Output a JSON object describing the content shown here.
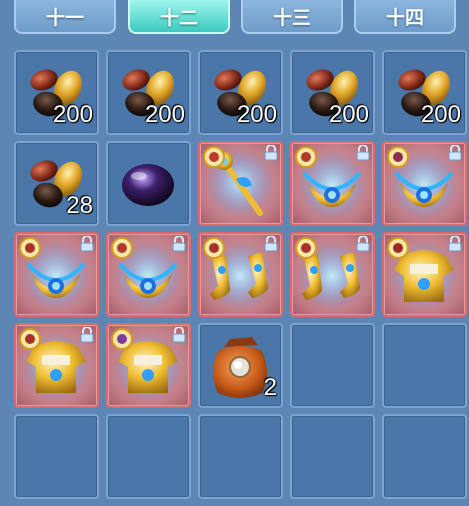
{
  "tabs": [
    {
      "label": "十一",
      "active": false
    },
    {
      "label": "十二",
      "active": true
    },
    {
      "label": "十三",
      "active": false
    },
    {
      "label": "十四",
      "active": false
    }
  ],
  "slots": [
    {
      "item": "beans",
      "count": "200",
      "locked": false
    },
    {
      "item": "beans",
      "count": "200",
      "locked": false
    },
    {
      "item": "beans",
      "count": "200",
      "locked": false
    },
    {
      "item": "beans",
      "count": "200",
      "locked": false
    },
    {
      "item": "beans",
      "count": "200",
      "locked": false
    },
    {
      "item": "beans",
      "count": "28",
      "locked": false
    },
    {
      "item": "dark-gem",
      "count": "",
      "locked": false
    },
    {
      "item": "golden-scepter",
      "count": "",
      "locked": true,
      "badge": "scepter-badge"
    },
    {
      "item": "golden-necklace",
      "count": "",
      "locked": true,
      "badge": "jar-badge"
    },
    {
      "item": "golden-necklace",
      "count": "",
      "locked": true,
      "badge": "horse-badge"
    },
    {
      "item": "golden-necklace",
      "count": "",
      "locked": true,
      "badge": "figure-badge"
    },
    {
      "item": "golden-necklace",
      "count": "",
      "locked": true,
      "badge": "jar-badge"
    },
    {
      "item": "golden-boots",
      "count": "",
      "locked": true,
      "badge": "figure-badge"
    },
    {
      "item": "golden-boots",
      "count": "",
      "locked": true,
      "badge": "figure-badge"
    },
    {
      "item": "golden-armor",
      "count": "",
      "locked": true,
      "badge": "helmet-badge"
    },
    {
      "item": "golden-armor",
      "count": "",
      "locked": true,
      "badge": "figure-badge"
    },
    {
      "item": "golden-armor",
      "count": "",
      "locked": true,
      "badge": "bird-badge"
    },
    {
      "item": "orange-pouch",
      "count": "2",
      "locked": false
    },
    {
      "item": "empty",
      "count": "",
      "locked": false
    },
    {
      "item": "empty",
      "count": "",
      "locked": false
    },
    {
      "item": "empty",
      "count": "",
      "locked": false
    },
    {
      "item": "empty",
      "count": "",
      "locked": false
    },
    {
      "item": "empty",
      "count": "",
      "locked": false
    },
    {
      "item": "empty",
      "count": "",
      "locked": false
    },
    {
      "item": "empty",
      "count": "",
      "locked": false
    }
  ],
  "colors": {
    "background": "#5d86b4",
    "active_tab": "#3cc9c0",
    "locked_slot": "#c07c86"
  }
}
